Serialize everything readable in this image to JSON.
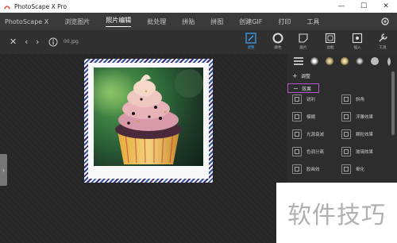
{
  "window": {
    "title": "PhotoScape X Pro",
    "minimize": "—",
    "maximize": "☐",
    "close": "✕"
  },
  "menu": {
    "items": [
      {
        "label": "PhotoScape X"
      },
      {
        "label": "浏览图片"
      },
      {
        "label": "照片编辑",
        "active": true
      },
      {
        "label": "批处理"
      },
      {
        "label": "拼贴"
      },
      {
        "label": "拼图"
      },
      {
        "label": "创建GIF"
      },
      {
        "label": "打印"
      },
      {
        "label": "工具"
      }
    ]
  },
  "toolbar": {
    "filename": "00.jpg",
    "tools": [
      {
        "label": "调整",
        "icon": "edit-icon",
        "active": true
      },
      {
        "label": "颜色",
        "icon": "circle-icon"
      },
      {
        "label": "贴片",
        "icon": "sticker-icon"
      },
      {
        "label": "边框",
        "icon": "frame-icon"
      },
      {
        "label": "插入",
        "icon": "insert-icon"
      },
      {
        "label": "工具",
        "icon": "tools-icon"
      }
    ]
  },
  "panel": {
    "section_adjust": {
      "symbol": "+",
      "label": "调整"
    },
    "section_effects": {
      "symbol": "−",
      "label": "效果"
    },
    "filters": [
      {
        "label": "锐利"
      },
      {
        "label": "斜角"
      },
      {
        "label": "模糊"
      },
      {
        "label": "浮雕效果"
      },
      {
        "label": "光源衰减"
      },
      {
        "label": "颗粒效果"
      },
      {
        "label": "色调分离"
      },
      {
        "label": "玻璃效果"
      },
      {
        "label": "胶画效"
      },
      {
        "label": "晕化"
      }
    ]
  },
  "watermark": {
    "text": "软件技巧"
  },
  "colors": {
    "accent": "#3ea6ff",
    "selection": "#b457c9"
  }
}
